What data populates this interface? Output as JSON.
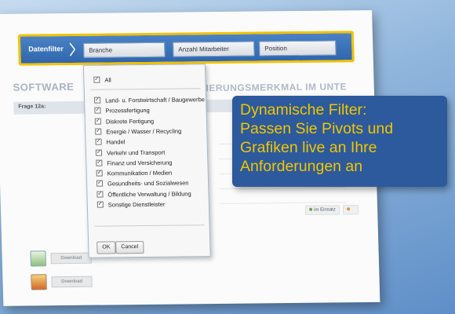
{
  "filterbar": {
    "label": "Datenfilter",
    "filters": [
      "Branche",
      "Anzahl Mitarbeiter",
      "Position"
    ]
  },
  "report": {
    "title": "SOFTWARE",
    "title2": "ZIERUNGSMERKMAL IM UNTE",
    "question": "Frage 12a:",
    "legend": [
      "im Einsatz",
      ""
    ]
  },
  "dropdown": {
    "all_label": "All",
    "options": [
      "Land- u. Forstwirtschaft / Baugewerbe",
      "Prozessfertigung",
      "Diskrete Fertigung",
      "Energie / Wasser / Recycling",
      "Handel",
      "Verkehr und Transport",
      "Finanz und Versicherung",
      "Kommunikation / Medien",
      "Gesundheits- und Sozialwesen",
      "Öffentliche Verwaltung / Bildung",
      "Sonstige Dienstleister"
    ],
    "ok_label": "OK",
    "cancel_label": "Cancel"
  },
  "downloads": [
    "Download",
    "Download"
  ],
  "callout": {
    "lines": [
      "Dynamische Filter:",
      "Passen Sie Pivots und",
      "Grafiken live an Ihre",
      "Anforderungen an"
    ]
  }
}
